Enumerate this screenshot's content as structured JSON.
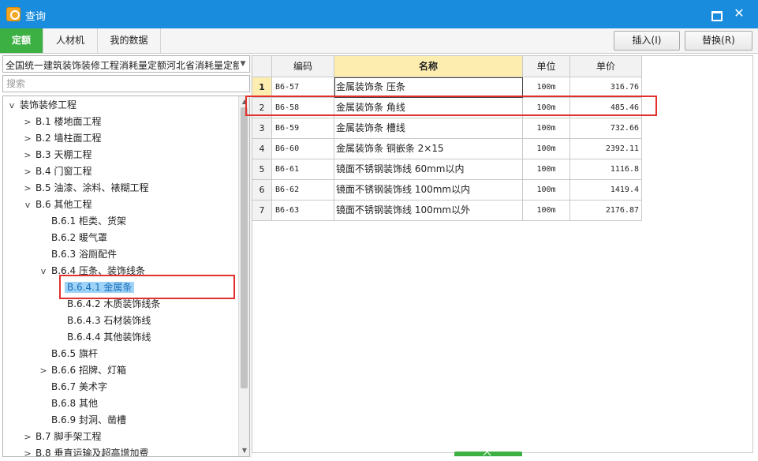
{
  "window": {
    "title": "查询",
    "maximize_icon": "maximize-icon",
    "close_label": "✕"
  },
  "tabs": [
    {
      "label": "定额",
      "active": true
    },
    {
      "label": "人材机",
      "active": false
    },
    {
      "label": "我的数据",
      "active": false
    }
  ],
  "toolbar": {
    "insert_label": "插入(I)",
    "replace_label": "替换(R)"
  },
  "library": {
    "selected": "全国统一建筑装饰装修工程消耗量定额河北省消耗量定额"
  },
  "search": {
    "placeholder": "搜索",
    "value": ""
  },
  "tree": [
    {
      "label": "装饰装修工程",
      "expander": "v"
    },
    {
      "label": "B.1 楼地面工程",
      "expander": ">"
    },
    {
      "label": "B.2 墙柱面工程",
      "expander": ">"
    },
    {
      "label": "B.3 天棚工程",
      "expander": ">"
    },
    {
      "label": "B.4 门窗工程",
      "expander": ">"
    },
    {
      "label": "B.5 油漆、涂料、裱糊工程",
      "expander": ">"
    },
    {
      "label": "B.6 其他工程",
      "expander": "v"
    },
    {
      "label": "B.6.1 柜类、货架",
      "expander": ""
    },
    {
      "label": "B.6.2 暖气罩",
      "expander": ""
    },
    {
      "label": "B.6.3 浴厕配件",
      "expander": ""
    },
    {
      "label": "B.6.4 压条、装饰线条",
      "expander": "v"
    },
    {
      "label": "B.6.4.1 金属条",
      "expander": "",
      "selected": true
    },
    {
      "label": "B.6.4.2 木质装饰线条",
      "expander": ""
    },
    {
      "label": "B.6.4.3 石材装饰线",
      "expander": ""
    },
    {
      "label": "B.6.4.4 其他装饰线",
      "expander": ""
    },
    {
      "label": "B.6.5 旗杆",
      "expander": ""
    },
    {
      "label": "B.6.6 招牌、灯箱",
      "expander": ">"
    },
    {
      "label": "B.6.7 美术字",
      "expander": ""
    },
    {
      "label": "B.6.8 其他",
      "expander": ""
    },
    {
      "label": "B.6.9 封洞、凿槽",
      "expander": ""
    },
    {
      "label": "B.7 脚手架工程",
      "expander": ">"
    },
    {
      "label": "B.8 垂直运输及超高增加费",
      "expander": ">"
    }
  ],
  "grid": {
    "columns": [
      "编码",
      "名称",
      "单位",
      "单价"
    ],
    "rows": [
      {
        "num": "1",
        "code": "B6-57",
        "name": "金属装饰条 压条",
        "unit": "100m",
        "price": "316.76"
      },
      {
        "num": "2",
        "code": "B6-58",
        "name": "金属装饰条 角线",
        "unit": "100m",
        "price": "485.46"
      },
      {
        "num": "3",
        "code": "B6-59",
        "name": "金属装饰条 槽线",
        "unit": "100m",
        "price": "732.66"
      },
      {
        "num": "4",
        "code": "B6-60",
        "name": "金属装饰条 铜嵌条 2×15",
        "unit": "100m",
        "price": "2392.11"
      },
      {
        "num": "5",
        "code": "B6-61",
        "name": "镜面不锈钢装饰线 60mm以内",
        "unit": "100m",
        "price": "1116.8"
      },
      {
        "num": "6",
        "code": "B6-62",
        "name": "镜面不锈钢装饰线 100mm以内",
        "unit": "100m",
        "price": "1419.4"
      },
      {
        "num": "7",
        "code": "B6-63",
        "name": "镜面不锈钢装饰线 100mm以外",
        "unit": "100m",
        "price": "2176.87"
      }
    ]
  },
  "colors": {
    "titlebar": "#1a8cde",
    "active_tab": "#3cb043",
    "highlight": "#e0312f",
    "header_sorted": "#fdeeb0"
  }
}
